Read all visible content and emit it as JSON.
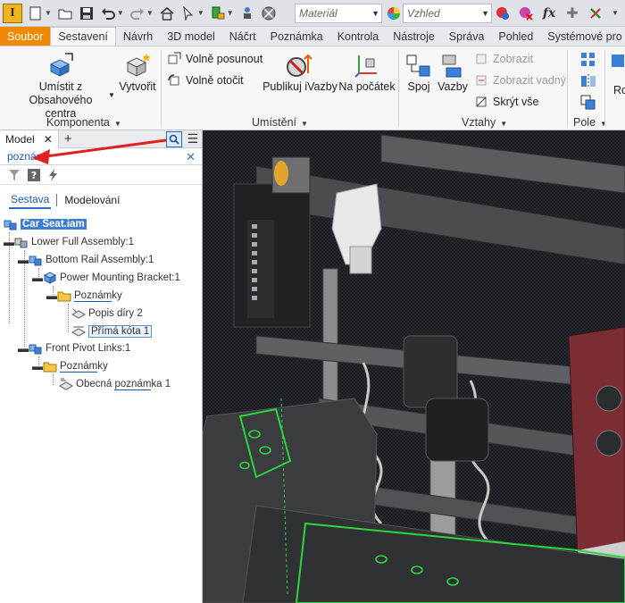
{
  "qat": {
    "app_letter": "I",
    "material_placeholder": "Materiál",
    "appearance_placeholder": "Vzhled",
    "fx_label": "fx"
  },
  "tabs": [
    {
      "label": "Soubor"
    },
    {
      "label": "Sestavení"
    },
    {
      "label": "Návrh"
    },
    {
      "label": "3D model"
    },
    {
      "label": "Náčrt"
    },
    {
      "label": "Poznámka"
    },
    {
      "label": "Kontrola"
    },
    {
      "label": "Nástroje"
    },
    {
      "label": "Správa"
    },
    {
      "label": "Pohled"
    },
    {
      "label": "Systémové pro"
    }
  ],
  "ribbon": {
    "komponenta": {
      "place_line1": "Umístit z",
      "place_line2": "Obsahového centra",
      "create": "Vytvořit",
      "label": "Komponenta"
    },
    "umisteni": {
      "free_move": "Volně posunout",
      "free_rotate": "Volně otočit",
      "publish": "Publikuj iVazby",
      "origin": "Na počátek",
      "label": "Umístění"
    },
    "vztahy": {
      "join": "Spoj",
      "constraints": "Vazby",
      "show": "Zobrazit",
      "show_failed": "Zobrazit vadný",
      "hide_all": "Skrýt vše",
      "label": "Vztahy"
    },
    "pole": {
      "label": "Pole"
    },
    "extra": {
      "label": "Ro"
    }
  },
  "browser": {
    "tab_label": "Model",
    "search_text": "poznám",
    "mode_assembly": "Sestava",
    "mode_modeling": "Modelování",
    "tree": [
      {
        "label": "Car Seat.iam"
      },
      {
        "label": "Lower Full Assembly:1"
      },
      {
        "label": "Bottom Rail Assembly:1"
      },
      {
        "label": "Power Mounting Bracket:1"
      },
      {
        "label_pre": "",
        "label_match": "Poznám",
        "label_post": "ky"
      },
      {
        "label": "Popis díry 2"
      },
      {
        "label": "Přímá kóta 1"
      },
      {
        "label": "Front Pivot Links:1"
      },
      {
        "label_pre": "",
        "label_match": "Poznám",
        "label_post": "ky"
      },
      {
        "label_pre": "Obecná ",
        "label_match": "poznám",
        "label_post": "ka 1"
      }
    ]
  },
  "colors": {
    "file_tab": "#ef8a00",
    "selection": "#3c7fd2",
    "arrow": "#e02020",
    "highlight_green": "#2bd63c"
  }
}
